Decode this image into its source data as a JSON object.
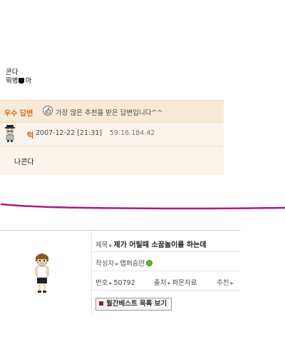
{
  "intro": {
    "line1": "콘다",
    "line2_pre": "뭐병",
    "line2_post": "아"
  },
  "best_answer": {
    "title": "우수 답변",
    "message": "가장 많은 추천을 받은 답변입니다^^",
    "author": "턱",
    "time": "2007-12-22 [21:31]",
    "ip": "59.16.184.42",
    "body": "나콘다"
  },
  "post_card": {
    "title_label": "제목",
    "title_value": "제가 어릴때 소꿉놀이를 하는데",
    "author_label": "작성자",
    "author_value": "랩퍼승만",
    "number_label": "번호",
    "number_value": "50792",
    "source_label": "출처",
    "source_value": "퍼온자료",
    "recommend_label": "추천",
    "button_label": "월간베스트 목록 보기"
  },
  "colors": {
    "best_title": "#d0711b",
    "author_name": "#c65a0f",
    "separator": "#b0197a",
    "status_dot": "#66b033"
  },
  "icons": {
    "thumbs_up": "thumbs-up-icon",
    "user_avatar": "user-avatar-icon",
    "status": "online-status-icon"
  }
}
